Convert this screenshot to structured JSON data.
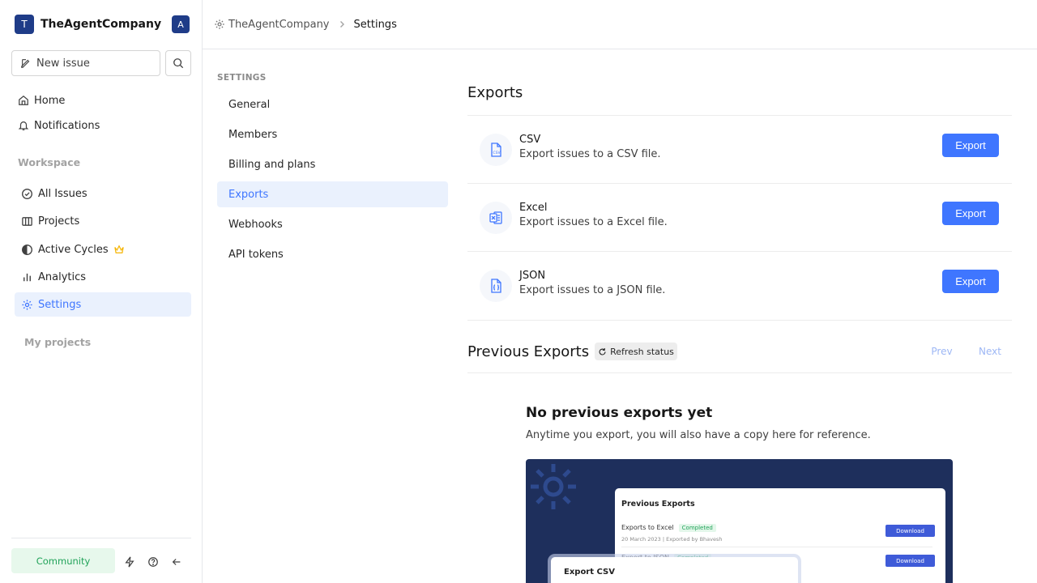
{
  "sidebar": {
    "workspace_logo": "T",
    "workspace_name": "TheAgentCompany",
    "user_avatar": "A",
    "new_issue": "New issue",
    "nav": {
      "home": "Home",
      "notifications": "Notifications"
    },
    "workspace_label": "Workspace",
    "workspace_items": {
      "all_issues": "All Issues",
      "projects": "Projects",
      "active_cycles": "Active Cycles",
      "analytics": "Analytics",
      "settings": "Settings"
    },
    "my_projects_label": "My projects",
    "community": "Community"
  },
  "header": {
    "crumb_workspace": "TheAgentCompany",
    "crumb_current": "Settings"
  },
  "settings_nav": {
    "label": "SETTINGS",
    "items": [
      "General",
      "Members",
      "Billing and plans",
      "Exports",
      "Webhooks",
      "API tokens"
    ],
    "active": "Exports"
  },
  "exports": {
    "title": "Exports",
    "items": [
      {
        "name": "CSV",
        "desc": "Export issues to a CSV file.",
        "button": "Export",
        "icon": "csv-file-icon"
      },
      {
        "name": "Excel",
        "desc": "Export issues to a Excel file.",
        "button": "Export",
        "icon": "excel-file-icon"
      },
      {
        "name": "JSON",
        "desc": "Export issues to a JSON file.",
        "button": "Export",
        "icon": "json-file-icon"
      }
    ]
  },
  "previous_exports": {
    "title": "Previous Exports",
    "refresh": "Refresh status",
    "prev": "Prev",
    "next": "Next"
  },
  "empty_state": {
    "title": "No previous exports yet",
    "desc": "Anytime you export, you will also have a copy here for reference.",
    "illustration": {
      "card_title": "Previous Exports",
      "rows": [
        {
          "name": "Exports to Excel",
          "status": "Completed",
          "meta": "20 March 2023  |  Exported by Bhavesh",
          "action": "Download"
        },
        {
          "name": "Export to JSON",
          "status": "Completed",
          "meta": "",
          "action": "Download"
        }
      ],
      "modal_title": "Export CSV"
    }
  },
  "colors": {
    "accent": "#3f76ff",
    "brand": "#1f3c88",
    "success": "#22a35a"
  }
}
